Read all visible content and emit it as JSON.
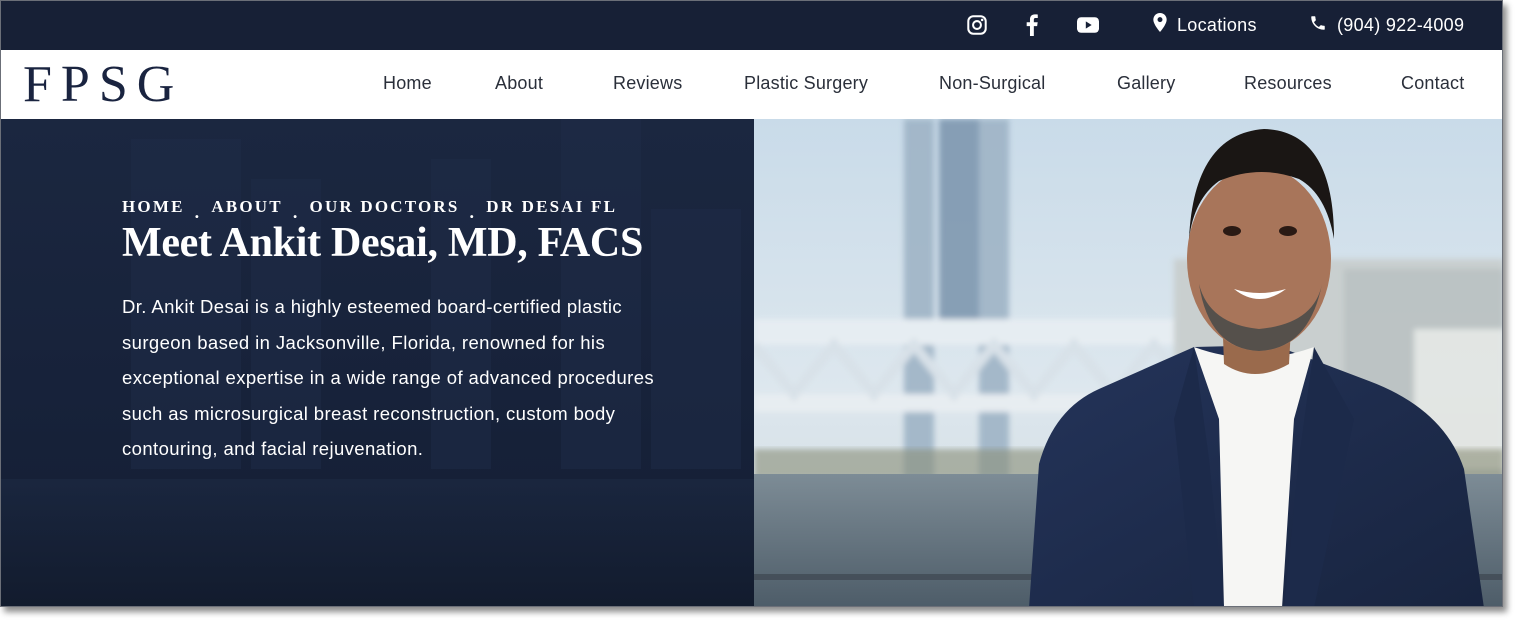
{
  "topbar": {
    "icons": [
      "instagram-icon",
      "facebook-icon",
      "youtube-icon"
    ],
    "locations_label": "Locations",
    "phone_label": "(904) 922-4009"
  },
  "header": {
    "logo": "FPSG",
    "nav": [
      "Home",
      "About",
      "Reviews",
      "Plastic Surgery",
      "Non-Surgical",
      "Gallery",
      "Resources",
      "Contact"
    ]
  },
  "hero": {
    "breadcrumb": [
      "HOME",
      "ABOUT",
      "OUR DOCTORS",
      "DR DESAI FL"
    ],
    "separator": ".",
    "title": "Meet Ankit Desai, MD, FACS",
    "body": "Dr. Ankit Desai is a highly esteemed board-certified plastic surgeon based in Jacksonville, Florida, renowned for his exceptional expertise in a wide range of advanced procedures such as microsurgical breast reconstruction, custom body contouring, and facial rejuvenation."
  },
  "colors": {
    "navy": "#172036",
    "hero_bg": "#17223a",
    "logo": "#1a2440",
    "nav_text": "#2a2f3a"
  }
}
